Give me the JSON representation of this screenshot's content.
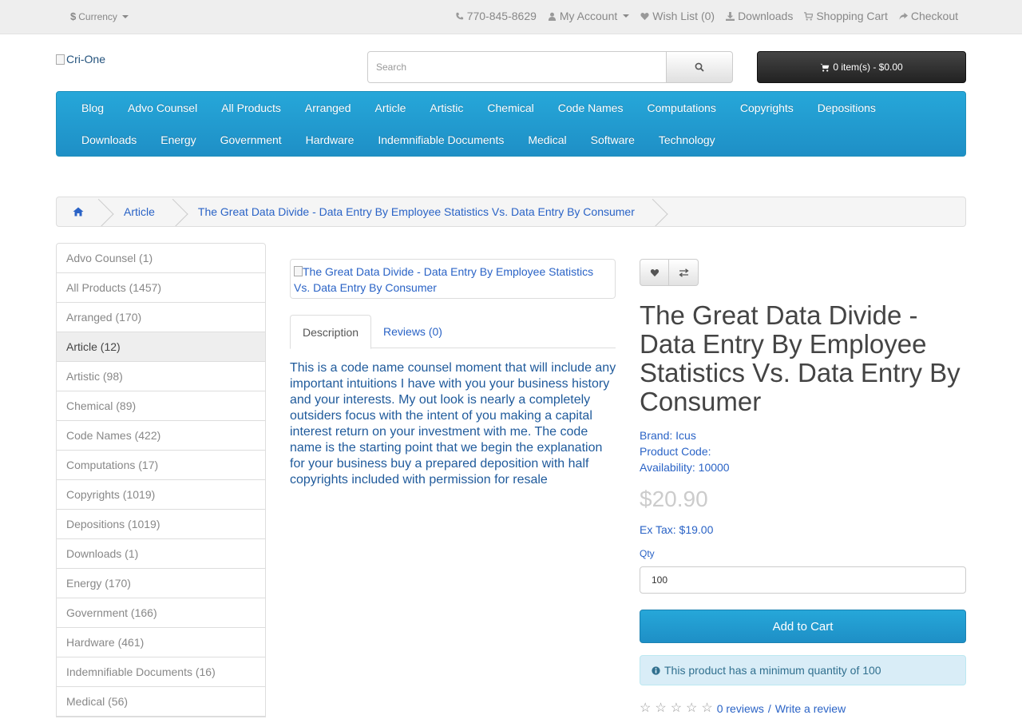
{
  "topbar": {
    "currency_label": "Currency",
    "phone": "770-845-8629",
    "my_account": "My Account",
    "wishlist": "Wish List (0)",
    "downloads": "Downloads",
    "shopping_cart": "Shopping Cart",
    "checkout": "Checkout"
  },
  "header": {
    "logo_alt": "Cri-One",
    "search_placeholder": "Search",
    "cart_summary": "0 item(s) - $0.00"
  },
  "menu": {
    "row1": [
      "Blog",
      "Advo Counsel",
      "All Products",
      "Arranged",
      "Article",
      "Artistic",
      "Chemical",
      "Code Names",
      "Computations",
      "Copyrights",
      "Depositions"
    ],
    "row2": [
      "Downloads",
      "Energy",
      "Government",
      "Hardware",
      "Indemnifiable Documents",
      "Medical",
      "Software",
      "Technology"
    ]
  },
  "breadcrumb": {
    "category": "Article",
    "current": "The Great Data Divide - Data Entry By Employee Statistics Vs. Data Entry By Consumer"
  },
  "sidebar": {
    "items": [
      "Advo Counsel (1)",
      "All Products (1457)",
      "Arranged (170)",
      "Article (12)",
      "Artistic (98)",
      "Chemical (89)",
      "Code Names (422)",
      "Computations (17)",
      "Copyrights (1019)",
      "Depositions (1019)",
      "Downloads (1)",
      "Energy (170)",
      "Government (166)",
      "Hardware (461)",
      "Indemnifiable Documents (16)",
      "Medical (56)"
    ],
    "active_index": 3
  },
  "product": {
    "image_alt": "The Great Data Divide - Data Entry By Employee Statistics Vs. Data Entry By Consumer",
    "tab_description": "Description",
    "tab_reviews": "Reviews (0)",
    "description": "This is a code name counsel moment that will include any important intuitions I have with you your business history and your interests. My out look is nearly a completely outsiders focus with the intent of you making a capital interest return on your investment with me. The code name is the starting point that we begin the explanation for your business buy a prepared deposition with half copyrights included with permission for resale",
    "title": "The Great Data Divide - Data Entry By Employee Statistics Vs. Data Entry By Consumer",
    "brand": "Brand: Icus",
    "product_code": "Product Code:",
    "availability": "Availability: 10000",
    "price": "$20.90",
    "ex_tax": "Ex Tax: $19.00",
    "qty_label": "Qty",
    "qty_value": "100",
    "add_to_cart": "Add to Cart",
    "min_qty_notice": "This product has a minimum quantity of 100",
    "reviews_link": "0 reviews",
    "write_review": "Write a review",
    "rating_stars": 0
  },
  "colors": {
    "accent": "#229ac8",
    "link": "#2a63c6",
    "cart_bg": "#303030",
    "alert_bg": "#d9edf7"
  }
}
